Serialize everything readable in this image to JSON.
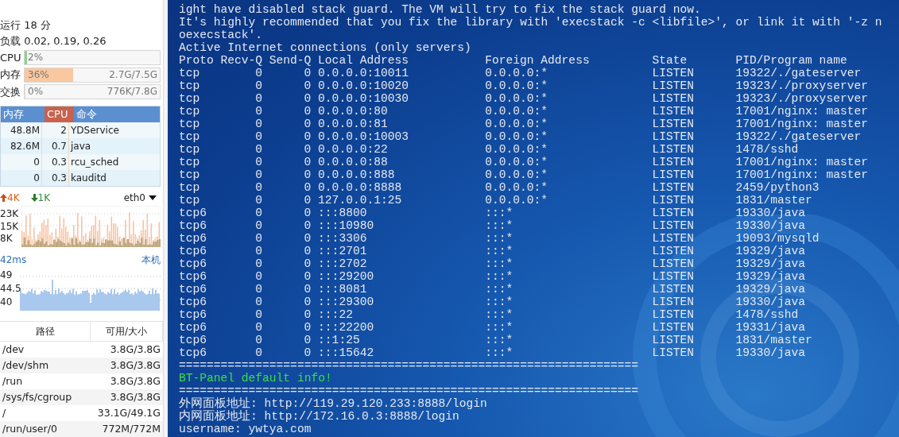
{
  "sidebar": {
    "uptime": "运行 18 分",
    "load": "负载 0.02, 0.19, 0.26",
    "meters": [
      {
        "label": "CPU",
        "percent": "2%",
        "level": 0.02,
        "color": "#8fd08f"
      },
      {
        "label": "内存",
        "percent": "36%",
        "detail": "2.7G/7.5G",
        "level": 0.36,
        "color": "#f9c8a0"
      },
      {
        "label": "交换",
        "percent": "0%",
        "detail": "776K/7.8G",
        "level": 0
      }
    ],
    "processes": {
      "columns": [
        {
          "label": "内存",
          "selected": false
        },
        {
          "label": "CPU",
          "selected": true
        },
        {
          "label": "命令",
          "selected": false
        }
      ],
      "rows": [
        [
          "48.8M",
          "2",
          "YDService"
        ],
        [
          "82.6M",
          "0.7",
          "java"
        ],
        [
          "0",
          "0.3",
          "rcu_sched"
        ],
        [
          "0",
          "0.3",
          "kauditd"
        ]
      ]
    },
    "network": {
      "upload": "4K",
      "download": "1K",
      "interface": "eth0",
      "axis_labels": [
        "23K",
        "15K",
        "8K"
      ]
    },
    "latency": {
      "value": "42ms",
      "host": "本机",
      "axis_labels": [
        "49",
        "44.5",
        "40"
      ]
    },
    "disks": {
      "columns": [
        "路径",
        "可用/大小"
      ],
      "rows": [
        [
          "/dev",
          "3.8G/3.8G"
        ],
        [
          "/dev/shm",
          "3.8G/3.8G"
        ],
        [
          "/run",
          "3.8G/3.8G"
        ],
        [
          "/sys/fs/cgroup",
          "3.8G/3.8G"
        ],
        [
          "/",
          "33.1G/49.1G"
        ],
        [
          "/run/user/0",
          "772M/772M"
        ]
      ]
    }
  },
  "terminal": {
    "lines_before": [
      "ight have disabled stack guard. The VM will try to fix the stack guard now.",
      "It's highly recommended that you fix the library with 'execstack -c <libfile>', or link it with '-z n",
      "oexecstack'.",
      "Active Internet connections (only servers)"
    ],
    "columns": [
      "Proto",
      "Recv-Q",
      "Send-Q",
      "Local Address",
      "Foreign Address",
      "State",
      "PID/Program name"
    ],
    "rows": [
      [
        "tcp",
        "0",
        "0",
        "0.0.0.0:10011",
        "0.0.0.0:*",
        "LISTEN",
        "19322/./gateserver"
      ],
      [
        "tcp",
        "0",
        "0",
        "0.0.0.0:10020",
        "0.0.0.0:*",
        "LISTEN",
        "19323/./proxyserver"
      ],
      [
        "tcp",
        "0",
        "0",
        "0.0.0.0:10030",
        "0.0.0.0:*",
        "LISTEN",
        "19323/./proxyserver"
      ],
      [
        "tcp",
        "0",
        "0",
        "0.0.0.0:80",
        "0.0.0.0:*",
        "LISTEN",
        "17001/nginx: master"
      ],
      [
        "tcp",
        "0",
        "0",
        "0.0.0.0:81",
        "0.0.0.0:*",
        "LISTEN",
        "17001/nginx: master"
      ],
      [
        "tcp",
        "0",
        "0",
        "0.0.0.0:10003",
        "0.0.0.0:*",
        "LISTEN",
        "19322/./gateserver"
      ],
      [
        "tcp",
        "0",
        "0",
        "0.0.0.0:22",
        "0.0.0.0:*",
        "LISTEN",
        "1478/sshd"
      ],
      [
        "tcp",
        "0",
        "0",
        "0.0.0.0:88",
        "0.0.0.0:*",
        "LISTEN",
        "17001/nginx: master"
      ],
      [
        "tcp",
        "0",
        "0",
        "0.0.0.0:888",
        "0.0.0.0:*",
        "LISTEN",
        "17001/nginx: master"
      ],
      [
        "tcp",
        "0",
        "0",
        "0.0.0.0:8888",
        "0.0.0.0:*",
        "LISTEN",
        "2459/python3"
      ],
      [
        "tcp",
        "0",
        "0",
        "127.0.0.1:25",
        "0.0.0.0:*",
        "LISTEN",
        "1831/master"
      ],
      [
        "tcp6",
        "0",
        "0",
        ":::8800",
        ":::*",
        "LISTEN",
        "19330/java"
      ],
      [
        "tcp6",
        "0",
        "0",
        ":::10980",
        ":::*",
        "LISTEN",
        "19330/java"
      ],
      [
        "tcp6",
        "0",
        "0",
        ":::3306",
        ":::*",
        "LISTEN",
        "19093/mysqld"
      ],
      [
        "tcp6",
        "0",
        "0",
        ":::2701",
        ":::*",
        "LISTEN",
        "19329/java"
      ],
      [
        "tcp6",
        "0",
        "0",
        ":::2702",
        ":::*",
        "LISTEN",
        "19329/java"
      ],
      [
        "tcp6",
        "0",
        "0",
        ":::29200",
        ":::*",
        "LISTEN",
        "19329/java"
      ],
      [
        "tcp6",
        "0",
        "0",
        ":::8081",
        ":::*",
        "LISTEN",
        "19329/java"
      ],
      [
        "tcp6",
        "0",
        "0",
        ":::29300",
        ":::*",
        "LISTEN",
        "19330/java"
      ],
      [
        "tcp6",
        "0",
        "0",
        ":::22",
        ":::*",
        "LISTEN",
        "1478/sshd"
      ],
      [
        "tcp6",
        "0",
        "0",
        ":::22200",
        ":::*",
        "LISTEN",
        "19331/java"
      ],
      [
        "tcp6",
        "0",
        "0",
        "::1:25",
        ":::*",
        "LISTEN",
        "1831/master"
      ],
      [
        "tcp6",
        "0",
        "0",
        ":::15642",
        ":::*",
        "LISTEN",
        "19330/java"
      ]
    ],
    "lines_after": [
      {
        "kind": "rule",
        "text": "=================================================================="
      },
      {
        "kind": "notice",
        "text": "BT-Panel default info!"
      },
      {
        "kind": "rule",
        "text": "=================================================================="
      },
      {
        "kind": "plain",
        "text": "外网面板地址: http://119.29.120.233:8888/login"
      },
      {
        "kind": "plain",
        "text": "内网面板地址: http://172.16.0.3:8888/login"
      },
      {
        "kind": "plain",
        "text": "username: ywtya.com"
      }
    ]
  }
}
